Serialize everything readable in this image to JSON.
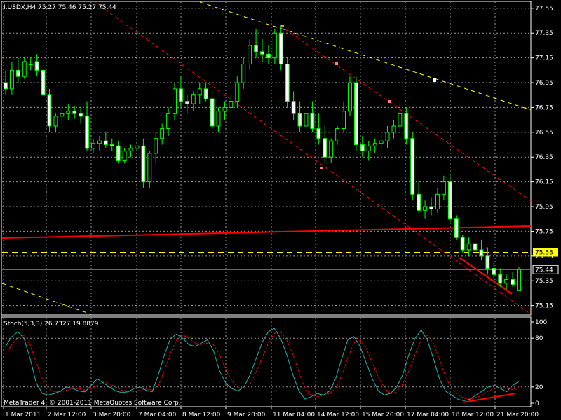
{
  "header": {
    "symbol_info": "I.USDX,H4  75.27 75.46 75.27 75.44",
    "indicator_info": "Stoch(5,3,3) 26.7327 19.8879",
    "copyright": "MetaTrader 4, © 2001-2011 MetaQuotes Software Corp."
  },
  "colors": {
    "background": "#000000",
    "grid": "#9a9a9a",
    "bull_candle": "#00ff00",
    "bear_candle": "#ffffff",
    "wick": "#00ff00",
    "level_red": "#ff0000",
    "trend_yellow": "#ffff00",
    "stoch_main": "#20b2aa",
    "stoch_signal": "#ff0000",
    "price_marker_bg": "#ffff00",
    "current_price_bg": "#000000"
  },
  "chart_data": [
    {
      "type": "candlestick",
      "title": "",
      "y_ticks": [
        "77.55",
        "77.35",
        "77.15",
        "76.95",
        "76.75",
        "76.55",
        "76.35",
        "76.15",
        "75.95",
        "75.75",
        "75.55",
        "75.35",
        "75.15"
      ],
      "ylim": [
        75.08,
        77.6
      ],
      "x_ticks": [
        "1 Mar 2011",
        "2 Mar 12:00",
        "3 Mar 20:00",
        "7 Mar 04:00",
        "8 Mar 12:00",
        "9 Mar 20:00",
        "11 Mar 04:00",
        "14 Mar 12:00",
        "15 Mar 20:00",
        "17 Mar 04:00",
        "18 Mar 12:00",
        "21 Mar 20:00"
      ],
      "price_markers": [
        {
          "label": "75.58",
          "value": 75.58,
          "style": "yellow-box"
        },
        {
          "label": "75.44",
          "value": 75.44,
          "style": "black-box"
        }
      ],
      "horizontal_levels": [
        {
          "value": 75.58,
          "style": "dashed-yellow"
        },
        {
          "value": 75.44,
          "style": "solid-gray"
        }
      ],
      "candles_ohlc": [
        [
          76.95,
          77.05,
          76.85,
          76.9
        ],
        [
          76.9,
          77.12,
          76.85,
          77.05
        ],
        [
          77.05,
          77.15,
          76.95,
          77.0
        ],
        [
          77.0,
          77.15,
          76.98,
          77.12
        ],
        [
          77.1,
          77.15,
          77.05,
          77.1
        ],
        [
          77.12,
          77.18,
          77.0,
          77.05
        ],
        [
          77.05,
          77.1,
          76.8,
          76.85
        ],
        [
          76.85,
          76.9,
          76.55,
          76.6
        ],
        [
          76.6,
          76.7,
          76.55,
          76.68
        ],
        [
          76.68,
          76.75,
          76.62,
          76.7
        ],
        [
          76.7,
          76.78,
          76.65,
          76.72
        ],
        [
          76.72,
          76.76,
          76.66,
          76.7
        ],
        [
          76.7,
          76.75,
          76.62,
          76.68
        ],
        [
          76.68,
          76.8,
          76.4,
          76.42
        ],
        [
          76.42,
          76.5,
          76.38,
          76.46
        ],
        [
          76.46,
          76.52,
          76.4,
          76.48
        ],
        [
          76.48,
          76.55,
          76.42,
          76.45
        ],
        [
          76.45,
          76.5,
          76.4,
          76.44
        ],
        [
          76.44,
          76.48,
          76.3,
          76.32
        ],
        [
          76.32,
          76.42,
          76.3,
          76.4
        ],
        [
          76.4,
          76.45,
          76.35,
          76.42
        ],
        [
          76.42,
          76.48,
          76.38,
          76.44
        ],
        [
          76.44,
          76.5,
          76.1,
          76.15
        ],
        [
          76.15,
          76.4,
          76.1,
          76.38
        ],
        [
          76.38,
          76.55,
          76.3,
          76.5
        ],
        [
          76.5,
          76.62,
          76.45,
          76.58
        ],
        [
          76.58,
          76.75,
          76.52,
          76.7
        ],
        [
          76.7,
          76.95,
          76.65,
          76.9
        ],
        [
          76.9,
          77.0,
          76.75,
          76.8
        ],
        [
          76.8,
          76.85,
          76.7,
          76.78
        ],
        [
          76.78,
          76.88,
          76.72,
          76.85
        ],
        [
          76.85,
          76.95,
          76.78,
          76.9
        ],
        [
          76.9,
          76.95,
          76.8,
          76.82
        ],
        [
          76.82,
          76.9,
          76.55,
          76.6
        ],
        [
          76.6,
          76.75,
          76.55,
          76.72
        ],
        [
          76.72,
          76.8,
          76.65,
          76.75
        ],
        [
          76.75,
          76.85,
          76.7,
          76.8
        ],
        [
          76.8,
          77.0,
          76.75,
          76.95
        ],
        [
          76.95,
          77.15,
          76.9,
          77.1
        ],
        [
          77.1,
          77.3,
          77.05,
          77.25
        ],
        [
          77.25,
          77.38,
          77.15,
          77.2
        ],
        [
          77.2,
          77.3,
          77.12,
          77.18
        ],
        [
          77.18,
          77.25,
          77.1,
          77.15
        ],
        [
          77.15,
          77.38,
          77.1,
          77.35
        ],
        [
          77.35,
          77.42,
          77.05,
          77.1
        ],
        [
          77.1,
          77.15,
          76.75,
          76.8
        ],
        [
          76.8,
          76.88,
          76.65,
          76.7
        ],
        [
          76.7,
          76.8,
          76.55,
          76.6
        ],
        [
          76.6,
          76.75,
          76.5,
          76.7
        ],
        [
          76.7,
          76.8,
          76.55,
          76.58
        ],
        [
          76.58,
          76.7,
          76.45,
          76.5
        ],
        [
          76.5,
          76.6,
          76.3,
          76.35
        ],
        [
          76.35,
          76.5,
          76.3,
          76.48
        ],
        [
          76.48,
          76.6,
          76.45,
          76.58
        ],
        [
          76.58,
          76.8,
          76.55,
          76.72
        ],
        [
          76.72,
          77.0,
          76.68,
          76.95
        ],
        [
          76.95,
          77.0,
          76.4,
          76.45
        ],
        [
          76.45,
          76.52,
          76.35,
          76.4
        ],
        [
          76.4,
          76.48,
          76.32,
          76.44
        ],
        [
          76.44,
          76.5,
          76.38,
          76.46
        ],
        [
          76.46,
          76.55,
          76.4,
          76.48
        ],
        [
          76.48,
          76.6,
          76.42,
          76.55
        ],
        [
          76.55,
          76.65,
          76.5,
          76.6
        ],
        [
          76.6,
          76.8,
          76.55,
          76.7
        ],
        [
          76.7,
          76.75,
          76.45,
          76.5
        ],
        [
          76.5,
          76.55,
          76.0,
          76.05
        ],
        [
          76.05,
          76.15,
          75.9,
          75.92
        ],
        [
          75.92,
          76.0,
          75.85,
          75.95
        ],
        [
          75.95,
          76.02,
          75.88,
          75.93
        ],
        [
          75.93,
          76.1,
          75.9,
          76.05
        ],
        [
          76.05,
          76.2,
          76.0,
          76.15
        ],
        [
          76.15,
          76.22,
          75.82,
          75.85
        ],
        [
          75.85,
          75.88,
          75.68,
          75.7
        ],
        [
          75.7,
          75.72,
          75.58,
          75.6
        ],
        [
          75.6,
          75.7,
          75.55,
          75.65
        ],
        [
          75.65,
          75.7,
          75.55,
          75.6
        ],
        [
          75.6,
          75.68,
          75.52,
          75.55
        ],
        [
          75.55,
          75.62,
          75.4,
          75.45
        ],
        [
          75.45,
          75.5,
          75.35,
          75.4
        ],
        [
          75.4,
          75.45,
          75.3,
          75.33
        ],
        [
          75.33,
          75.4,
          75.28,
          75.36
        ],
        [
          75.36,
          75.42,
          75.3,
          75.32
        ],
        [
          75.27,
          75.46,
          75.27,
          75.44
        ]
      ]
    },
    {
      "type": "line",
      "title": "",
      "y_ticks": [
        "100",
        "80",
        "20",
        "0"
      ],
      "ylim": [
        0,
        100
      ],
      "series_main": [
        70,
        82,
        88,
        80,
        55,
        25,
        12,
        10,
        12,
        15,
        20,
        18,
        15,
        14,
        22,
        30,
        25,
        20,
        15,
        13,
        14,
        18,
        20,
        16,
        14,
        35,
        60,
        80,
        85,
        80,
        72,
        70,
        74,
        78,
        65,
        40,
        25,
        18,
        15,
        20,
        35,
        55,
        75,
        88,
        92,
        80,
        60,
        35,
        15,
        5,
        8,
        12,
        10,
        15,
        30,
        55,
        78,
        82,
        70,
        50,
        30,
        15,
        10,
        12,
        20,
        35,
        60,
        80,
        90,
        78,
        55,
        30,
        15,
        10,
        5,
        3,
        5,
        10,
        15,
        20,
        22,
        18,
        14,
        22,
        27
      ],
      "series_signal": [
        60,
        72,
        80,
        84,
        72,
        50,
        30,
        18,
        14,
        14,
        16,
        18,
        18,
        16,
        18,
        22,
        26,
        24,
        20,
        16,
        14,
        14,
        16,
        18,
        16,
        22,
        40,
        62,
        78,
        84,
        80,
        74,
        72,
        74,
        72,
        60,
        42,
        28,
        20,
        18,
        24,
        38,
        56,
        74,
        86,
        88,
        78,
        60,
        38,
        18,
        10,
        8,
        10,
        12,
        18,
        34,
        56,
        74,
        78,
        68,
        50,
        32,
        18,
        12,
        14,
        24,
        40,
        60,
        78,
        84,
        74,
        54,
        32,
        18,
        10,
        6,
        5,
        7,
        10,
        15,
        18,
        20,
        18,
        17,
        20
      ]
    }
  ]
}
